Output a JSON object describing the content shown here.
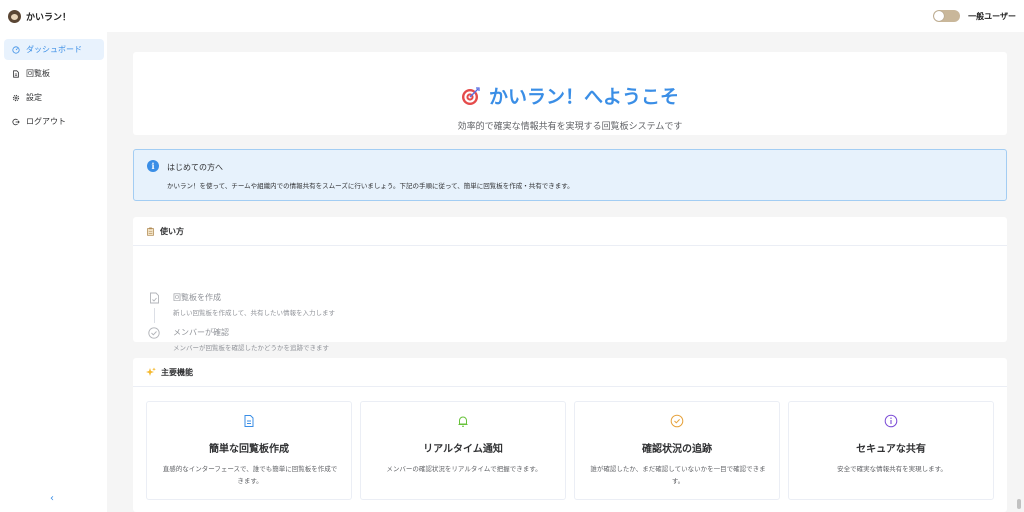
{
  "app": {
    "name": "かいラン！"
  },
  "header": {
    "user_role": "一般ユーザー"
  },
  "sidebar": {
    "items": [
      {
        "label": "ダッシュボード",
        "icon": "dashboard-icon",
        "active": true
      },
      {
        "label": "回覧板",
        "icon": "document-icon",
        "active": false
      },
      {
        "label": "設定",
        "icon": "gear-icon",
        "active": false
      },
      {
        "label": "ログアウト",
        "icon": "logout-icon",
        "active": false
      }
    ],
    "collapse_glyph": "‹"
  },
  "hero": {
    "title": "かいラン！へようこそ",
    "subtitle": "効率的で確実な情報共有を実現する回覧板システムです"
  },
  "info": {
    "title": "はじめての方へ",
    "text": "かいラン！を使って、チームや組織内での情報共有をスムーズに行いましょう。下記の手順に従って、簡単に回覧板を作成・共有できます。"
  },
  "usage": {
    "heading": "使い方",
    "steps": [
      {
        "title": "回覧板を作成",
        "desc": "新しい回覧板を作成して、共有したい情報を入力します"
      },
      {
        "title": "メンバーが確認",
        "desc": "メンバーが回覧板を確認したかどうかを追跡できます"
      }
    ]
  },
  "features": {
    "heading": "主要機能",
    "items": [
      {
        "title": "簡単な回覧板作成",
        "desc": "直感的なインターフェースで、誰でも簡単に回覧板を作成できます。",
        "color": "#3a8ee6"
      },
      {
        "title": "リアルタイム通知",
        "desc": "メンバーの確認状況をリアルタイムで把握できます。",
        "color": "#67c23a"
      },
      {
        "title": "確認状況の追跡",
        "desc": "誰が確認したか、まだ確認していないかを一目で確認できます。",
        "color": "#e6a23c"
      },
      {
        "title": "セキュアな共有",
        "desc": "安全で確実な情報共有を実現します。",
        "color": "#7b4bd6"
      }
    ]
  },
  "colors": {
    "accent": "#3a8ee6",
    "info_bg": "#e7f2fc",
    "info_border": "#a3cdf3"
  }
}
